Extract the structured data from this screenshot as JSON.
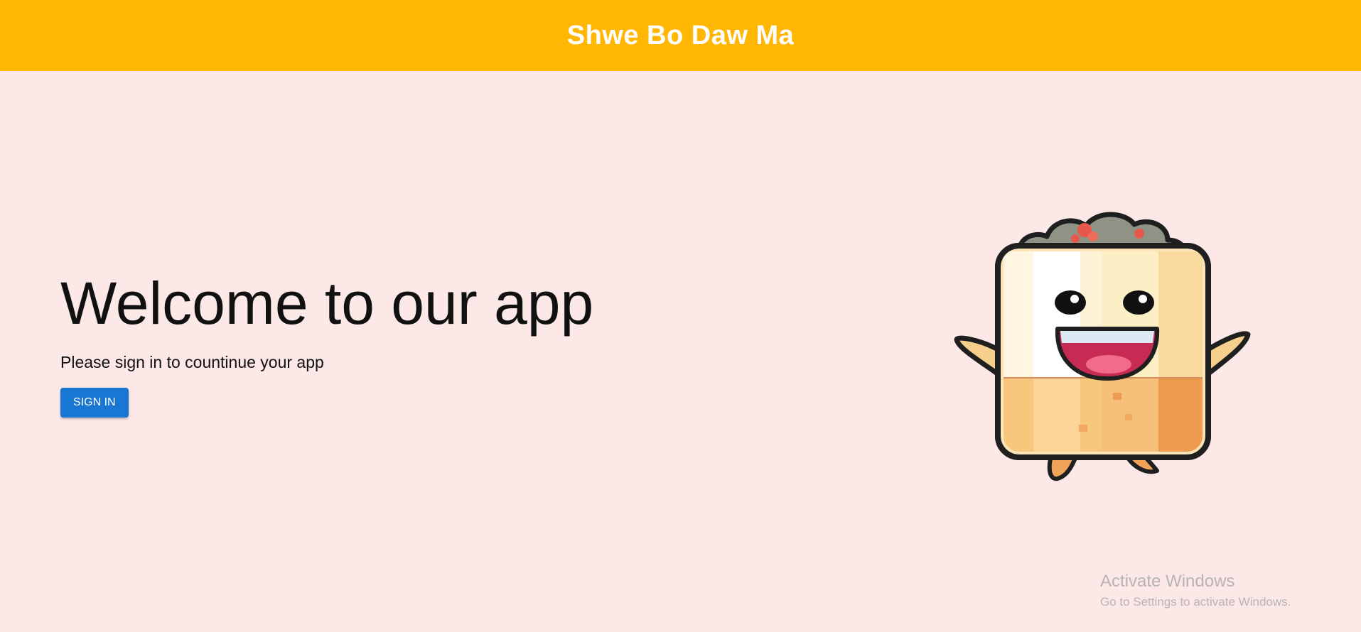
{
  "header": {
    "title": "Shwe Bo Daw Ma"
  },
  "hero": {
    "title": "Welcome to our app",
    "subtitle": "Please sign in to countinue your app",
    "sign_in_label": "SIGN IN"
  },
  "mascot": {
    "icon": "smiling-cartoon-mascot-icon"
  },
  "watermark": {
    "title": "Activate Windows",
    "subtitle": "Go to Settings to activate Windows."
  },
  "colors": {
    "header_bg": "#ffb703",
    "page_bg": "#fce9e7",
    "button_bg": "#1976d2"
  }
}
